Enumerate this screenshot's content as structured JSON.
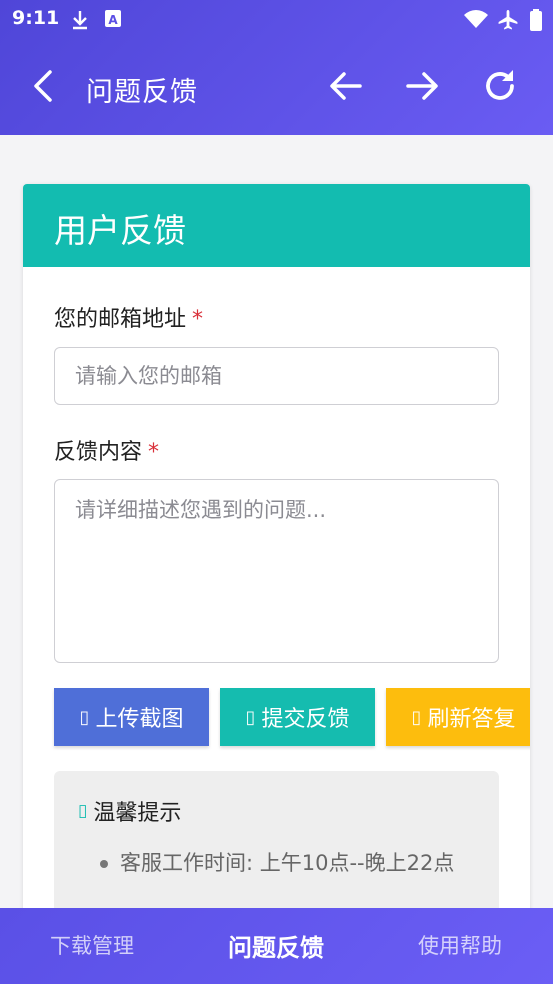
{
  "status_bar": {
    "time": "9:11"
  },
  "app_bar": {
    "title": "问题反馈"
  },
  "card": {
    "title": "用户反馈",
    "email_label": "您的邮箱地址",
    "email_required": "*",
    "email_placeholder": "请输入您的邮箱",
    "content_label": "反馈内容",
    "content_required": "*",
    "content_placeholder": "请详细描述您遇到的问题..."
  },
  "buttons": {
    "upload_label": "上传截图",
    "upload_icon": "upload-icon",
    "submit_label": "提交反馈",
    "submit_icon": "send-icon",
    "refresh_label": "刷新答复",
    "refresh_icon": "refresh-icon"
  },
  "tips": {
    "title": "温馨提示",
    "items": [
      "客服工作时间: 上午10点--晚上22点"
    ]
  },
  "bottom_nav": {
    "items": [
      {
        "label": "下载管理"
      },
      {
        "label": "问题反馈"
      },
      {
        "label": "使用帮助"
      }
    ]
  },
  "colors": {
    "header": "#5b4fe4",
    "teal": "#13bcb0",
    "upload_btn": "#4f6fd8",
    "submit_btn": "#15bcaf",
    "refresh_btn": "#fdbd0d",
    "required": "#d9303a"
  }
}
